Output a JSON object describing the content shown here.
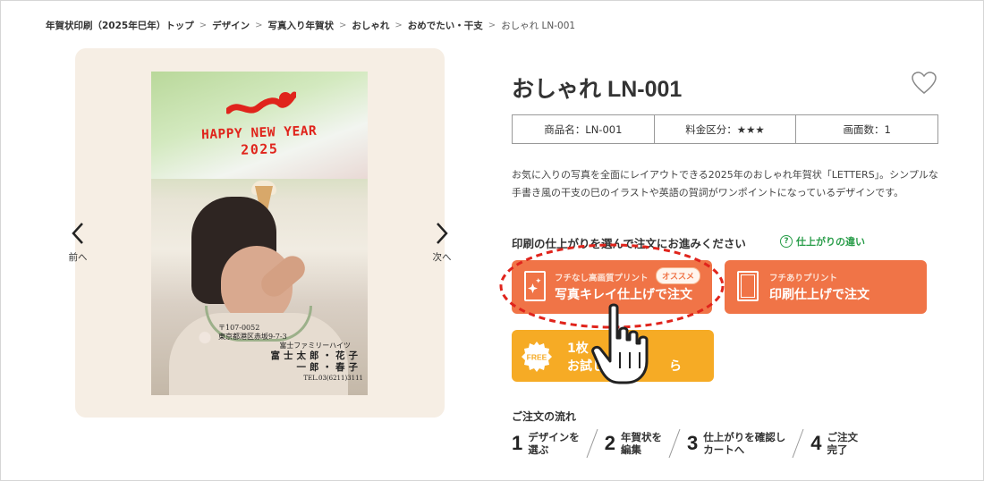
{
  "breadcrumb": [
    {
      "label": "年賀状印刷（2025年巳年）トップ"
    },
    {
      "label": "デザイン"
    },
    {
      "label": "写真入り年賀状"
    },
    {
      "label": "おしゃれ"
    },
    {
      "label": "おめでたい・干支"
    },
    {
      "label": "おしゃれ LN-001"
    }
  ],
  "preview": {
    "card_text": {
      "greeting": "HAPPY NEW YEAR",
      "year": "2025",
      "zip": "〒107-0052",
      "address1": "東京都港区赤坂9-7-3",
      "address2": "富士ファミリーハイツ",
      "name1": "富士太郎・花子",
      "name2": "一郎・春子",
      "tel": "TEL.03(6211)3111"
    },
    "prev_label": "前へ",
    "next_label": "次へ"
  },
  "product": {
    "title": "おしゃれ LN-001",
    "spec": {
      "name": "商品名：LN-001",
      "price_class": "料金区分：★★★",
      "faces": "画面数：1"
    },
    "description": "お気に入りの写真を全面にレイアウトできる2025年のおしゃれ年賀状「LETTERS」。シンプルな手書き風の干支の巳のイラストや英語の賀詞がワンポイントになっているデザインです。",
    "order_prompt": "印刷の仕上がりを選んで注文にお進みください",
    "finish_diff_link": "仕上がりの違い",
    "buttons": {
      "borderless": {
        "sub": "フチなし高画質プリント",
        "badge": "オススメ",
        "main": "写真キレイ仕上げで注文"
      },
      "bordered": {
        "sub": "フチありプリント",
        "main": "印刷仕上げで注文"
      },
      "free": {
        "badge": "FREE",
        "line1": "1枚",
        "line2a": "お試し",
        "line2b": "ら"
      }
    }
  },
  "flow": {
    "title": "ご注文の流れ",
    "steps": [
      {
        "num": "1",
        "text": "デザインを\n選ぶ"
      },
      {
        "num": "2",
        "text": "年賀状を\n編集"
      },
      {
        "num": "3",
        "text": "仕上がりを確認し\nカートへ"
      },
      {
        "num": "4",
        "text": "ご注文\n完了"
      }
    ]
  },
  "colors": {
    "accent_orange": "#f07447",
    "free_yellow": "#f6ab25",
    "link_green": "#2a9d4a",
    "highlight_red": "#e0241c",
    "preview_bg": "#f6eee4"
  }
}
